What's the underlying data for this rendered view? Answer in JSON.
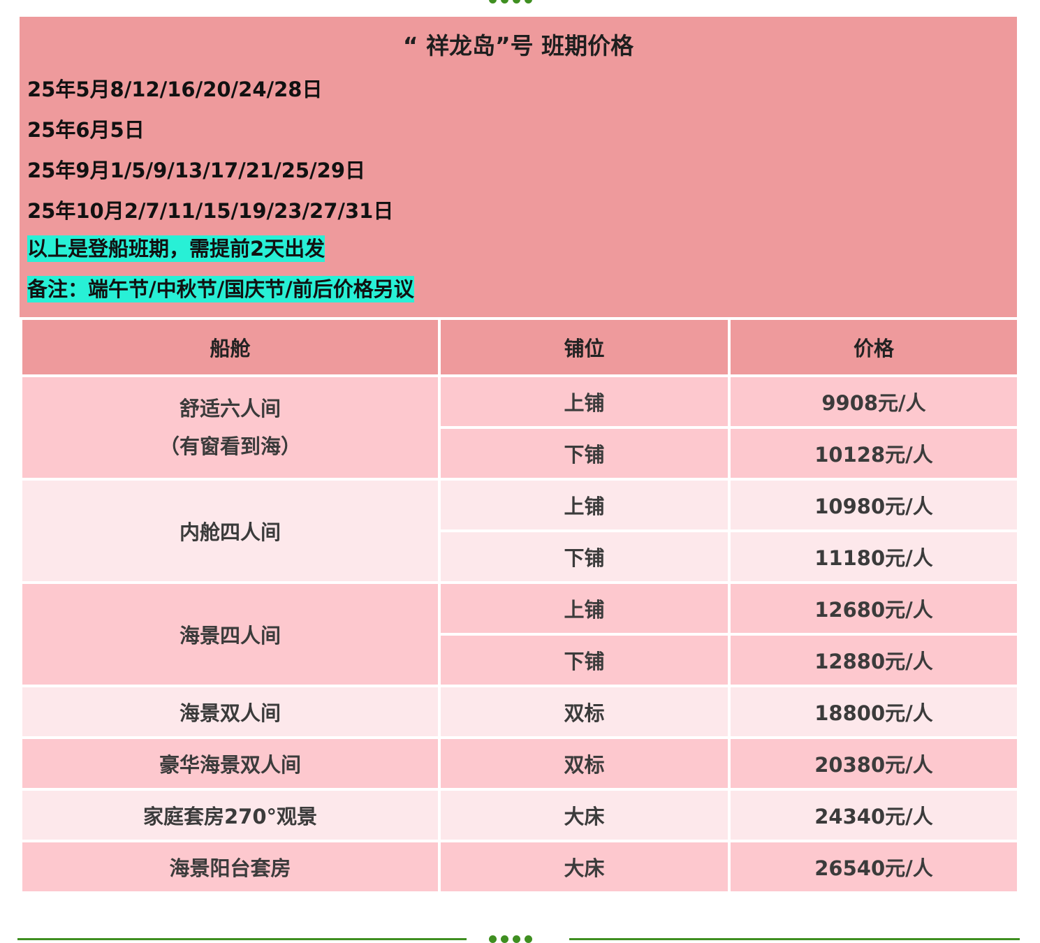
{
  "header": {
    "title": "“ 祥龙岛”号 班期价格",
    "dates": [
      "25年5月8/12/16/20/24/28日",
      "25年6月5日",
      "25年9月1/5/9/13/17/21/25/29日",
      "25年10月2/7/11/15/19/23/27/31日"
    ],
    "note_boarding": "以上是登船班期，需提前2天出发",
    "note_holiday": "备注：端午节/中秋节/国庆节/前后价格另议"
  },
  "table": {
    "columns": [
      "船舱",
      "铺位",
      "价格"
    ],
    "groups": [
      {
        "cabin_line1": "舒适六人间",
        "cabin_line2": "（有窗看到海）",
        "rows": [
          {
            "berth": "上铺",
            "price": "9908元/人"
          },
          {
            "berth": "下铺",
            "price": "10128元/人"
          }
        ]
      },
      {
        "cabin_line1": "内舱四人间",
        "rows": [
          {
            "berth": "上铺",
            "price": "10980元/人"
          },
          {
            "berth": "下铺",
            "price": "11180元/人"
          }
        ]
      },
      {
        "cabin_line1": "海景四人间",
        "rows": [
          {
            "berth": "上铺",
            "price": "12680元/人"
          },
          {
            "berth": "下铺",
            "price": "12880元/人"
          }
        ]
      },
      {
        "cabin_line1": "海景双人间",
        "rows": [
          {
            "berth": "双标",
            "price": "18800元/人"
          }
        ]
      },
      {
        "cabin_line1": "豪华海景双人间",
        "rows": [
          {
            "berth": "双标",
            "price": "20380元/人"
          }
        ]
      },
      {
        "cabin_line1": "家庭套房270°观景",
        "rows": [
          {
            "berth": "大床",
            "price": "24340元/人"
          }
        ]
      },
      {
        "cabin_line1": "海景阳台套房",
        "rows": [
          {
            "berth": "大床",
            "price": "26540元/人"
          }
        ]
      }
    ]
  },
  "colors": {
    "header_bg": "#ee9a9c",
    "row_pink": "#fdc8ce",
    "row_light": "#fde8eb",
    "highlight": "#28f0d6",
    "accent_green": "#3f8f21"
  }
}
